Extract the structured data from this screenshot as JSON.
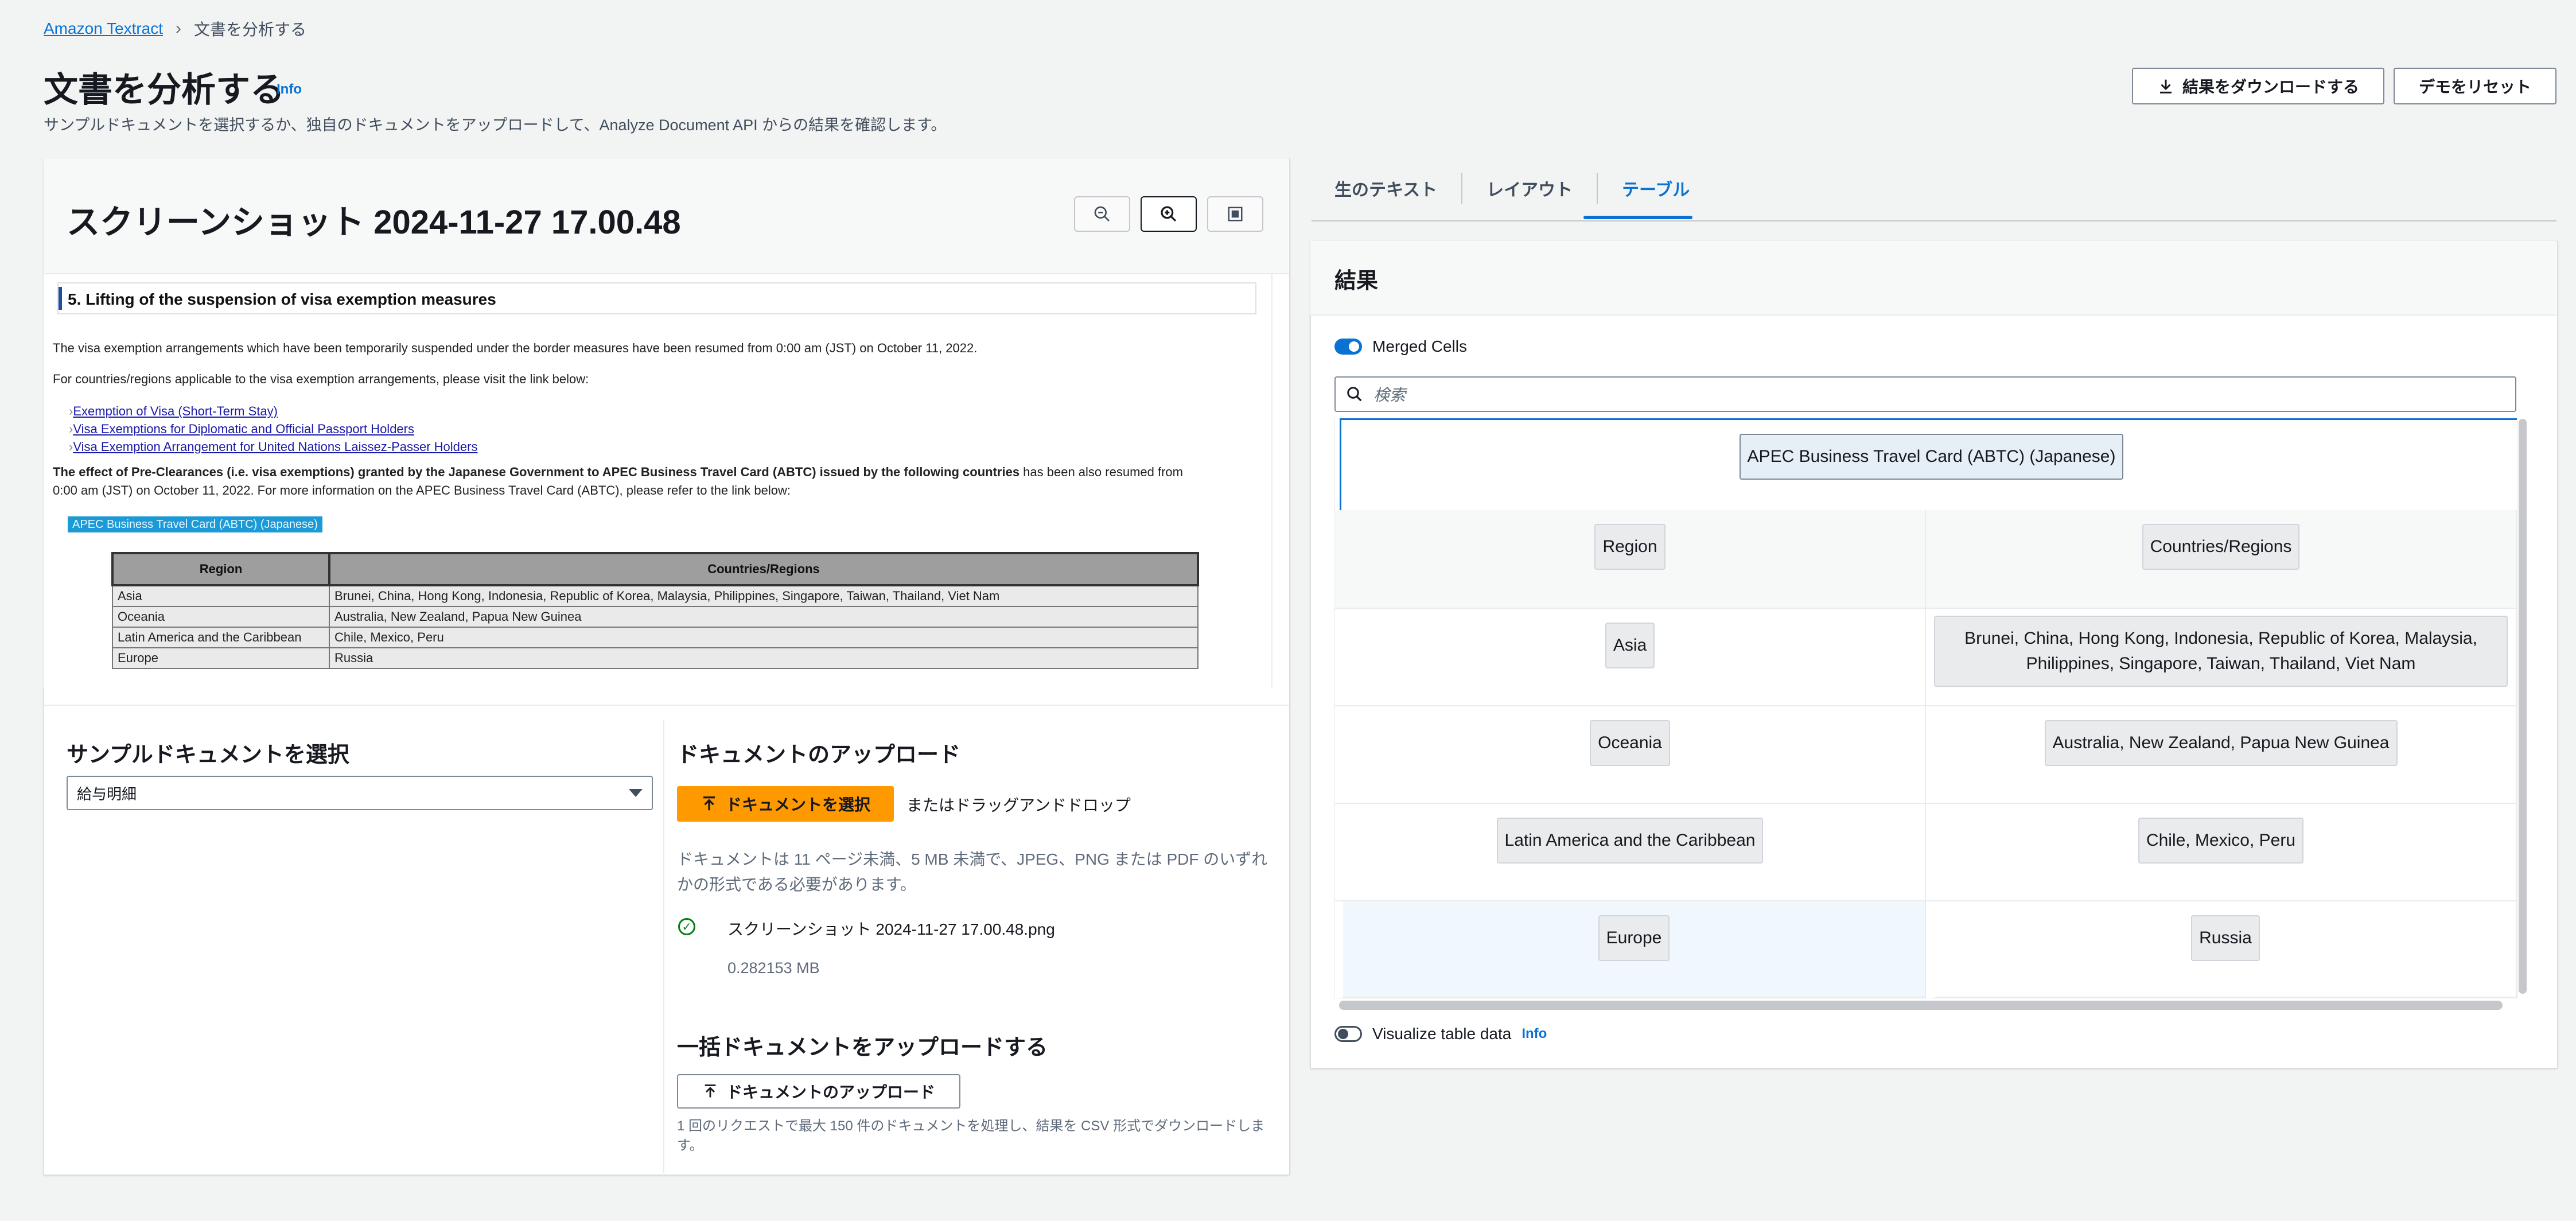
{
  "breadcrumb": {
    "root": "Amazon Textract",
    "current": "文書を分析する"
  },
  "header": {
    "title": "文書を分析する",
    "info": "Info",
    "subtitle": "サンプルドキュメントを選択するか、独自のドキュメントをアップロードして、Analyze Document API からの結果を確認します。",
    "download_button": "結果をダウンロードする",
    "reset_button": "デモをリセット"
  },
  "viewer": {
    "title": "スクリーンショット 2024-11-27 17.00.48",
    "zoom_out_icon": "zoom-out-icon",
    "zoom_in_icon": "zoom-in-icon",
    "fit_icon": "fit-page-icon"
  },
  "document": {
    "heading": "5. Lifting of the suspension of visa exemption measures",
    "para1": "The visa exemption arrangements which have been temporarily suspended under the border measures have been resumed from 0:00 am (JST) on October 11, 2022.",
    "para2": "For countries/regions applicable to the visa exemption arrangements, please visit the link below:",
    "links": [
      "Exemption of Visa (Short-Term Stay)",
      "Visa Exemptions for Diplomatic and Official Passport Holders",
      "Visa Exemption Arrangement for United Nations Laissez-Passer Holders"
    ],
    "para3_bold": "The effect of Pre-Clearances (i.e. visa exemptions) granted by the Japanese Government to APEC Business Travel Card (ABTC) issued by the following countries",
    "para3_rest": " has been also resumed from",
    "para3_line2": "0:00 am (JST) on October 11, 2022. For more information on the APEC Business Travel Card (ABTC), please refer to the link below:",
    "apec_tag": "APEC Business Travel Card (ABTC) (Japanese)",
    "table_headers": [
      "Region",
      "Countries/Regions"
    ],
    "table_rows": [
      [
        "Asia",
        "Brunei, China, Hong Kong, Indonesia, Republic of Korea, Malaysia, Philippines, Singapore, Taiwan, Thailand, Viet Nam"
      ],
      [
        "Oceania",
        "Australia, New Zealand, Papua New Guinea"
      ],
      [
        "Latin America and the Caribbean",
        "Chile, Mexico, Peru"
      ],
      [
        "Europe",
        "Russia"
      ]
    ]
  },
  "sample": {
    "title": "サンプルドキュメントを選択",
    "selected": "給与明細"
  },
  "upload": {
    "title": "ドキュメントのアップロード",
    "choose_button": "ドキュメントを選択",
    "drag_text": "またはドラッグアンドドロップ",
    "constraint_line1": "ドキュメントは 11 ページ未満、5 MB 未満で、JPEG、PNG または PDF のいずれ",
    "constraint_line2": "かの形式である必要があります。",
    "file_name": "スクリーンショット 2024-11-27 17.00.48.png",
    "file_size": "0.282153 MB"
  },
  "bulk": {
    "title": "一括ドキュメントをアップロードする",
    "button": "ドキュメントのアップロード",
    "note_line1": "1 回のリクエストで最大 150 件のドキュメントを処理し、結果を CSV 形式でダウンロードしま",
    "note_line2": "す。"
  },
  "tabs": [
    "生のテキスト",
    "レイアウト",
    "テーブル"
  ],
  "results": {
    "title": "結果",
    "merged_cells_label": "Merged Cells",
    "search_placeholder": "検索",
    "table_title": "APEC Business Travel Card (ABTC) (Japanese)",
    "headers": [
      "Region",
      "Countries/Regions"
    ],
    "rows": [
      [
        "Asia",
        "Brunei, China, Hong Kong, Indonesia, Republic of Korea, Malaysia, Philippines, Singapore, Taiwan, Thailand, Viet Nam"
      ],
      [
        "Oceania",
        "Australia, New Zealand, Papua New Guinea"
      ],
      [
        "Latin America and the Caribbean",
        "Chile, Mexico, Peru"
      ],
      [
        "Europe",
        "Russia"
      ]
    ],
    "visualize_label": "Visualize table data",
    "visualize_info": "Info"
  },
  "colors": {
    "accent": "#0972d3",
    "primary_button": "#ff9900",
    "success": "#037f0c"
  }
}
